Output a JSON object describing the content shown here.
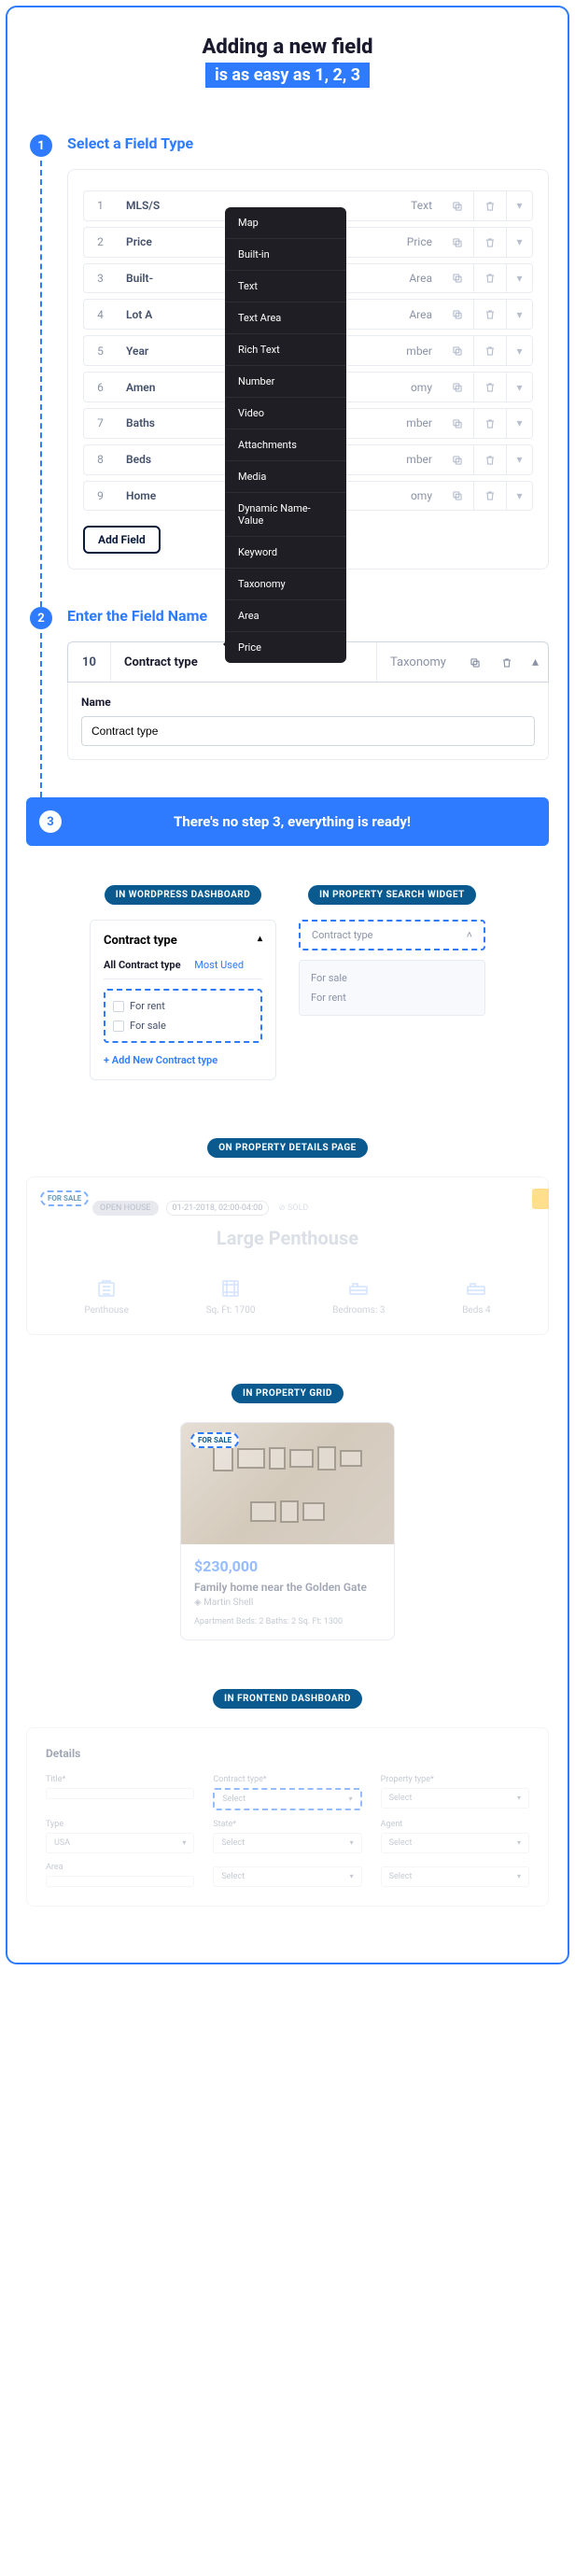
{
  "title": {
    "line1": "Adding a new field",
    "line2": "is as easy as 1, 2, 3"
  },
  "steps": {
    "s1": {
      "num": "1",
      "label": "Select a Field Type"
    },
    "s2": {
      "num": "2",
      "label": "Enter the Field Name"
    },
    "s3": {
      "num": "3",
      "label": "There's no step 3, everything is ready!"
    }
  },
  "field_rows": [
    {
      "idx": "1",
      "name": "MLS/S",
      "type": "Text"
    },
    {
      "idx": "2",
      "name": "Price",
      "type": "Price"
    },
    {
      "idx": "3",
      "name": "Built-",
      "type": "Area"
    },
    {
      "idx": "4",
      "name": "Lot A",
      "type": "Area"
    },
    {
      "idx": "5",
      "name": "Year",
      "type": "mber"
    },
    {
      "idx": "6",
      "name": "Amen",
      "type": "omy"
    },
    {
      "idx": "7",
      "name": "Baths",
      "type": "mber"
    },
    {
      "idx": "8",
      "name": "Beds",
      "type": "mber"
    },
    {
      "idx": "9",
      "name": "Home",
      "type": "omy"
    }
  ],
  "add_field_btn": "Add Field",
  "dropdown": [
    "Map",
    "Built-in",
    "Text",
    "Text Area",
    "Rich Text",
    "Number",
    "Video",
    "Attachments",
    "Media",
    "Dynamic Name-Value",
    "Keyword",
    "Taxonomy",
    "Area",
    "Price"
  ],
  "step2_row": {
    "idx": "10",
    "name": "Contract type",
    "type": "Taxonomy"
  },
  "step2_form": {
    "label": "Name",
    "value": "Contract type"
  },
  "badges": {
    "wp": "IN WORDPRESS DASHBOARD",
    "widget": "IN PROPERTY SEARCH WIDGET",
    "details": "ON PROPERTY DETAILS PAGE",
    "grid": "IN PROPERTY GRID",
    "frontend": "IN FRONTEND DASHBOARD"
  },
  "wp_card": {
    "title": "Contract type",
    "tab_all": "All Contract type",
    "tab_most": "Most Used",
    "opts": [
      "For rent",
      "For sale"
    ],
    "add_new": "+ Add New Contract type"
  },
  "widget": {
    "label": "Contract type",
    "opts": [
      "For sale",
      "For rent"
    ]
  },
  "details": {
    "tag": "FOR SALE",
    "open_house": "OPEN HOUSE",
    "date": "01-21-2018, 02:00-04:00",
    "sold_label": "SOLD",
    "title": "Large Penthouse",
    "features": [
      {
        "label": "Penthouse"
      },
      {
        "label": "Sq. Ft: 1700"
      },
      {
        "label": "Bedrooms: 3"
      },
      {
        "label": "Beds 4"
      }
    ]
  },
  "grid": {
    "tag": "FOR SALE",
    "price": "$230,000",
    "title": "Family home near the Golden Gate",
    "agent": "Martin Shell",
    "meta": "Apartment   Beds: 2   Baths: 2   Sq. Ft: 1300"
  },
  "frontend": {
    "heading": "Details",
    "fields": [
      {
        "label": "Title*",
        "val": ""
      },
      {
        "label": "Contract type*",
        "val": "Select",
        "highlight": true
      },
      {
        "label": "Property type*",
        "val": "Select"
      },
      {
        "label": "Type",
        "val": "USA"
      },
      {
        "label": "State*",
        "val": "Select"
      },
      {
        "label": "Agent",
        "val": "Select"
      },
      {
        "label": "Area",
        "val": ""
      },
      {
        "label": "",
        "val": "Select"
      },
      {
        "label": "",
        "val": "Select"
      }
    ]
  }
}
